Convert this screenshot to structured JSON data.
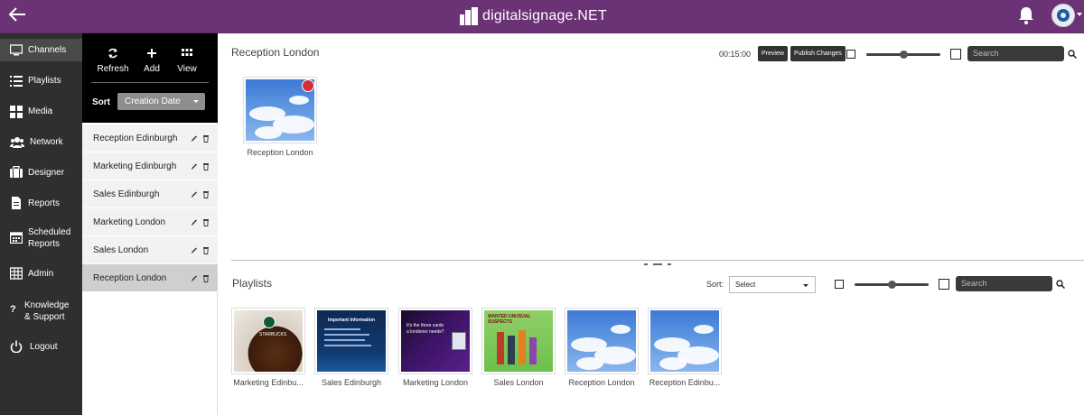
{
  "app": {
    "logo_text": "digitalsignage.NET",
    "brand_color": "#6b3375"
  },
  "leftnav": {
    "items": [
      {
        "label": "Channels",
        "icon": "monitor-icon"
      },
      {
        "label": "Playlists",
        "icon": "list-icon"
      },
      {
        "label": "Media",
        "icon": "grid-icon"
      },
      {
        "label": "Network",
        "icon": "users-icon"
      },
      {
        "label": "Designer",
        "icon": "briefcase-icon"
      },
      {
        "label": "Reports",
        "icon": "file-icon"
      },
      {
        "label": "Scheduled",
        "label2": "Reports",
        "icon": "calendar-icon"
      },
      {
        "label": "Admin",
        "icon": "table-icon"
      },
      {
        "label": "Knowledge",
        "label2": "& Support",
        "icon": "question-icon"
      },
      {
        "label": "Logout",
        "icon": "power-icon"
      }
    ]
  },
  "toolbar": {
    "refresh_label": "Refresh",
    "add_label": "Add",
    "view_label": "View",
    "sort_label": "Sort",
    "sort_value": "Creation Date"
  },
  "channels": [
    {
      "name": "Reception Edinburgh"
    },
    {
      "name": "Marketing Edinburgh"
    },
    {
      "name": "Sales Edinburgh"
    },
    {
      "name": "Marketing London"
    },
    {
      "name": "Sales London"
    },
    {
      "name": "Reception London",
      "selected": true
    }
  ],
  "main": {
    "title": "Reception London",
    "duration": "00:15:00",
    "preview_label": "Preview",
    "publish_label": "Publish Changes",
    "search_placeholder": "Search",
    "items": [
      {
        "caption": "Reception London"
      }
    ]
  },
  "bottom": {
    "title": "Playlists",
    "sort_label": "Sort:",
    "sort_value": "Select",
    "search_placeholder": "Search",
    "items": [
      {
        "caption": "Marketing Edinbu...",
        "thumb_text": "STARBUCKS"
      },
      {
        "caption": "Sales Edinburgh",
        "thumb_text": "Important Information"
      },
      {
        "caption": "Marketing London",
        "thumb_text": "It's the three cards a londoner needs?"
      },
      {
        "caption": "Sales London",
        "thumb_text": "WANTED UNUSUAL SUSPECTS"
      },
      {
        "caption": "Reception London",
        "thumb_text": ""
      },
      {
        "caption": "Reception Edinbu...",
        "thumb_text": ""
      }
    ]
  }
}
